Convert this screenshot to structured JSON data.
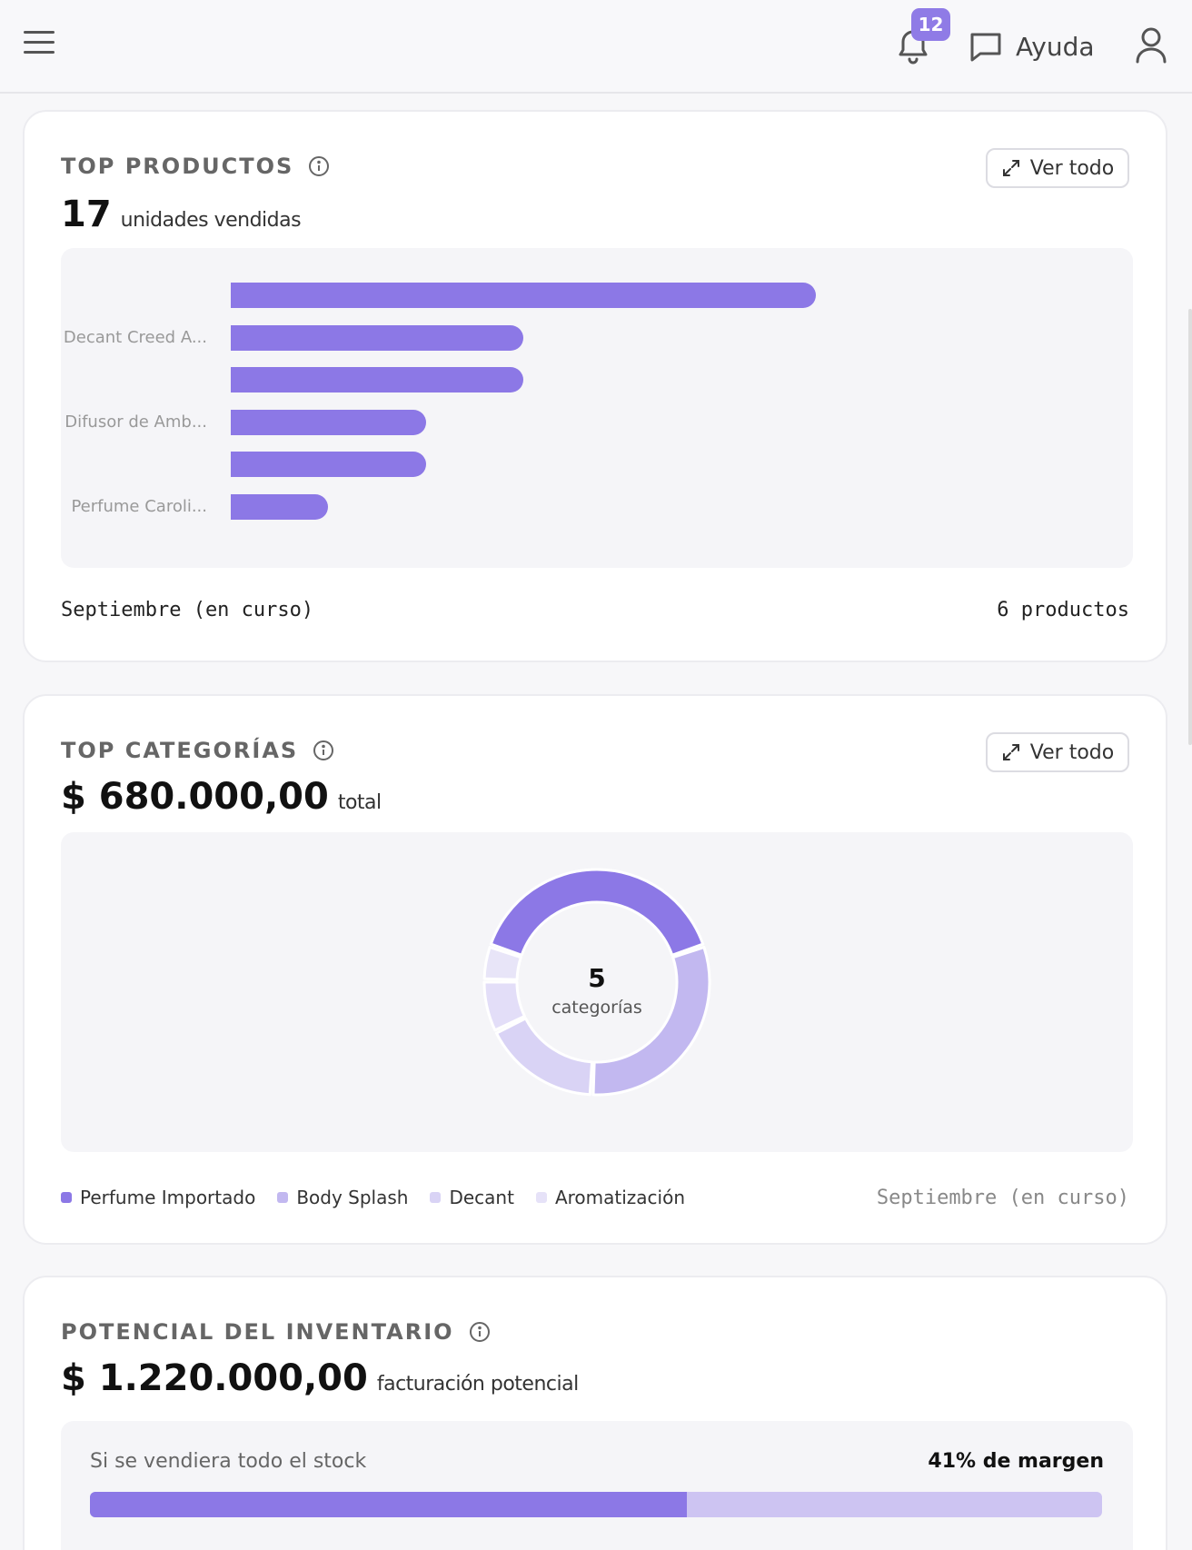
{
  "header": {
    "menu_icon": "hamburger-icon",
    "notifications_count": "12",
    "help_label": "Ayuda"
  },
  "top_products": {
    "title": "TOP PRODUCTOS",
    "metric_value": "17",
    "metric_suffix": "unidades vendidas",
    "view_all_label": "Ver todo",
    "period": "Septiembre (en curso)",
    "count_label": "6 productos",
    "chart_data": {
      "type": "bar",
      "orientation": "horizontal",
      "categories": [
        "",
        "Decant Creed A...",
        "",
        "Difusor de Amb...",
        "",
        "Perfume Caroli..."
      ],
      "values": [
        6,
        3,
        3,
        2,
        2,
        1
      ],
      "xlim": [
        0,
        8
      ],
      "grid": false,
      "color": "#8c78e6"
    }
  },
  "top_categories": {
    "title": "TOP CATEGORÍAS",
    "metric_value": "$ 680.000,00",
    "metric_suffix": "total",
    "view_all_label": "Ver todo",
    "center_value": "5",
    "center_label": "categorías",
    "period": "Septiembre (en curso)",
    "legend": [
      {
        "label": "Perfume Importado",
        "color": "#8c78e6"
      },
      {
        "label": "Body Splash",
        "color": "#c2b8f0"
      },
      {
        "label": "Decant",
        "color": "#d9d3f5"
      },
      {
        "label": "Aromatización",
        "color": "#e6e2f8"
      }
    ],
    "chart_data": {
      "type": "pie",
      "donut": true,
      "categories": [
        "Perfume Importado",
        "Body Splash",
        "Decant",
        "Aromatización",
        ""
      ],
      "values": [
        0.395,
        0.31,
        0.17,
        0.075,
        0.05
      ],
      "colors": [
        "#8c78e6",
        "#c2b8f0",
        "#d9d3f5",
        "#e3def8",
        "#e8e5f8"
      ]
    }
  },
  "inventory": {
    "title": "POTENCIAL DEL INVENTARIO",
    "metric_value": "$ 1.220.000,00",
    "metric_suffix": "facturación potencial",
    "stock_label": "Si se vendiera todo el stock",
    "margin_label": "41% de margen",
    "progress_fraction": 0.59
  }
}
